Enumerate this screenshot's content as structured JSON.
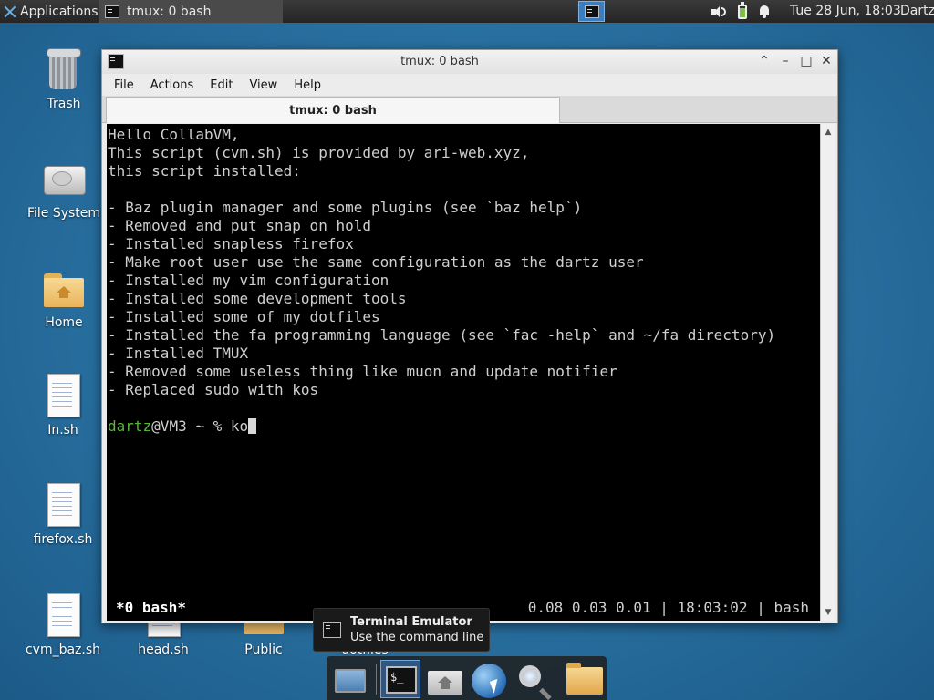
{
  "top_panel": {
    "applications_label": "Applications",
    "task_title": "tmux: 0 bash",
    "clock": "Tue 28 Jun, 18:03",
    "user": "Dartz",
    "icons": [
      "xfce-logo-icon",
      "terminal-icon",
      "speaker-icon",
      "battery-icon",
      "bell-icon"
    ],
    "accent": "#3b7ec0"
  },
  "desktop": {
    "icons": [
      {
        "label": "Trash",
        "icon": "trash-icon"
      },
      {
        "label": "File System",
        "icon": "drive-icon"
      },
      {
        "label": "Home",
        "icon": "home-folder-icon"
      },
      {
        "label": "In.sh",
        "icon": "script-file-icon"
      },
      {
        "label": "firefox.sh",
        "icon": "script-file-icon"
      },
      {
        "label": "cvm_baz.sh",
        "icon": "script-file-icon"
      },
      {
        "label": "head.sh",
        "icon": "script-file-icon"
      },
      {
        "label": "Public",
        "icon": "folder-icon"
      },
      {
        "label": "dotfiles",
        "icon": "folder-icon"
      }
    ]
  },
  "window": {
    "title": "tmux: 0 bash",
    "menu": [
      "File",
      "Actions",
      "Edit",
      "View",
      "Help"
    ],
    "tab_label": "tmux: 0 bash",
    "controls": [
      "chevron-up-icon",
      "minimize-icon",
      "maximize-icon",
      "close-icon"
    ]
  },
  "terminal": {
    "lines": [
      "Hello CollabVM,",
      "This script (cvm.sh) is provided by ari-web.xyz,",
      "this script installed:",
      "",
      "- Baz plugin manager and some plugins (see `baz help`)",
      "- Removed and put snap on hold",
      "- Installed snapless firefox",
      "- Make root user use the same configuration as the dartz user",
      "- Installed my vim configuration",
      "- Installed some development tools",
      "- Installed some of my dotfiles",
      "- Installed the fa programming language (see `fac -help` and ~/fa directory)",
      "- Installed TMUX",
      "- Removed some useless thing like muon and update notifier",
      "- Replaced sudo with kos"
    ],
    "prompt_user": "dartz",
    "prompt_rest": "@VM3 ~ % ",
    "input": "ko",
    "status_left": "*0 bash*",
    "status_right": "0.08 0.03 0.01 | 18:03:02 | bash",
    "prompt_color": "#5ab53a"
  },
  "tooltip": {
    "title": "Terminal Emulator",
    "subtitle": "Use the command line"
  },
  "dock": {
    "items": [
      "show-desktop-icon",
      "terminal-icon",
      "home-folder-icon",
      "web-browser-icon",
      "app-finder-icon",
      "folder-icon"
    ]
  }
}
